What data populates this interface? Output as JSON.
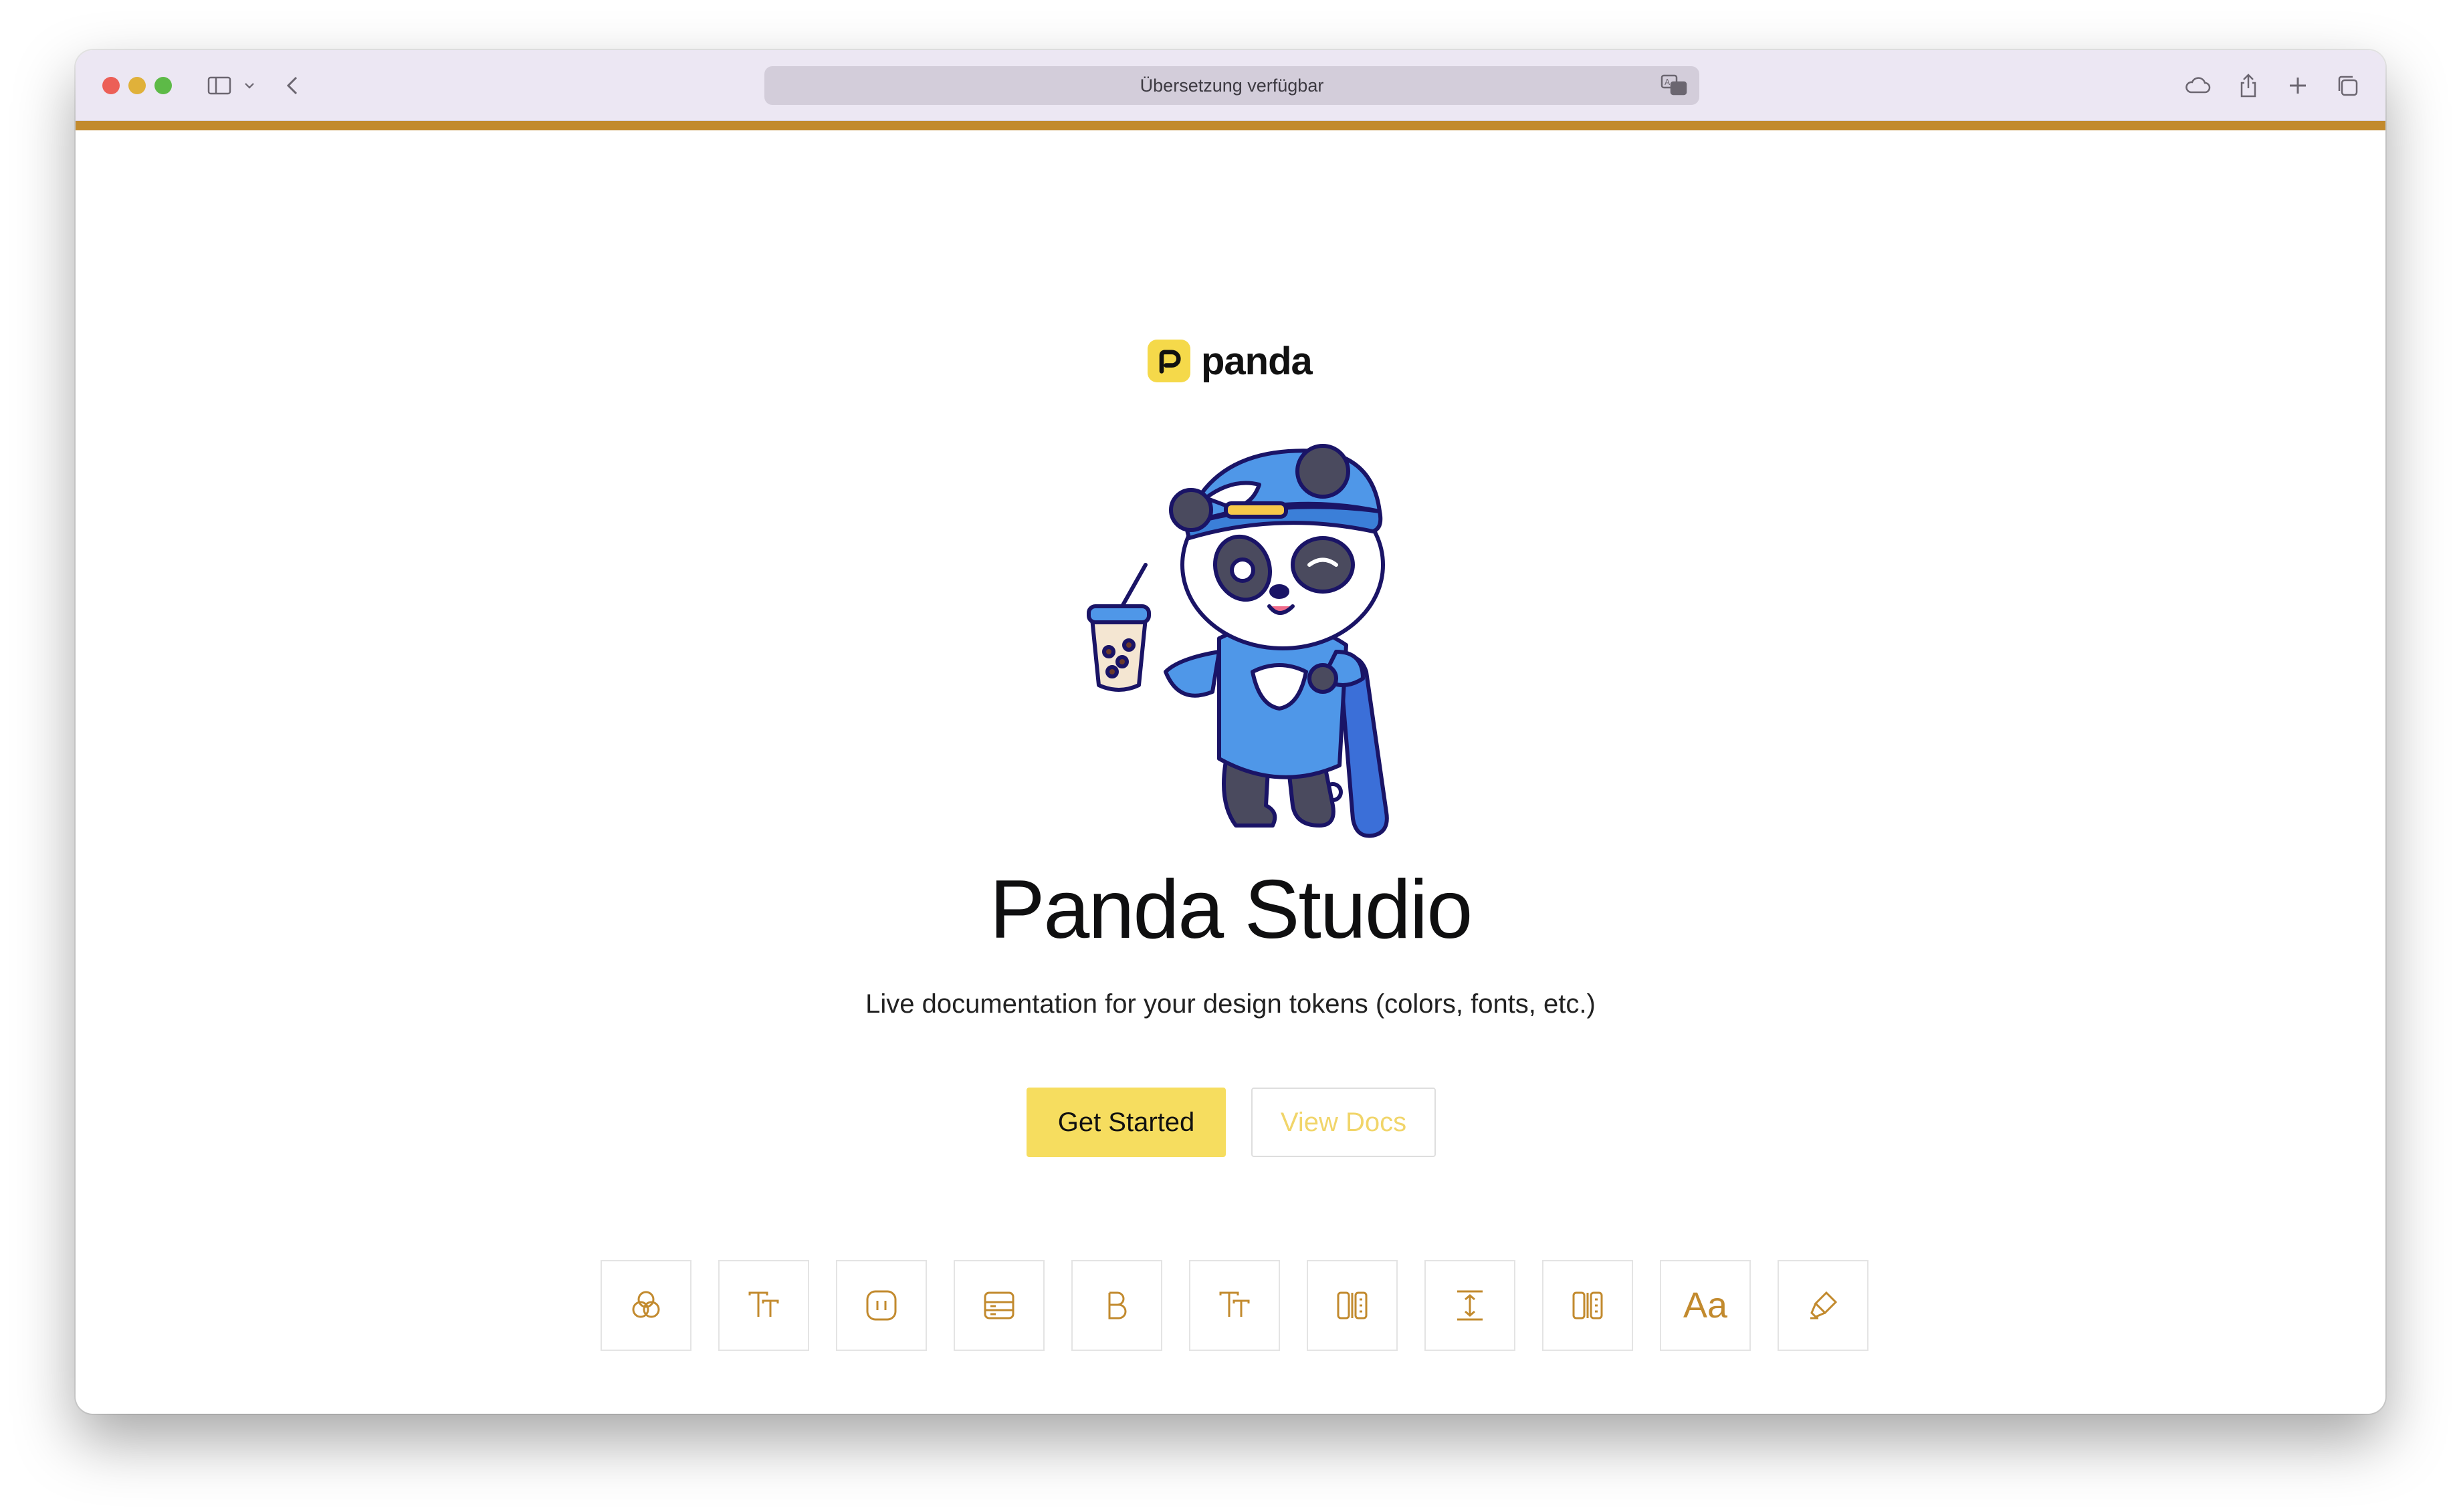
{
  "browser": {
    "address_bar_text": "Übersetzung verfügbar",
    "accent_color": "#c28a2e",
    "icons": [
      "sidebar-toggle-icon",
      "chevron-down-icon",
      "back-icon",
      "translate-icon",
      "icloud-icon",
      "share-icon",
      "new-tab-icon",
      "tabs-overview-icon"
    ]
  },
  "page": {
    "logo_text": "panda",
    "title": "Panda Studio",
    "subtitle": "Live documentation for your design tokens (colors, fonts, etc.)",
    "primary_button": "Get Started",
    "secondary_button": "View Docs",
    "brand_color": "#f6dd5f",
    "token_tiles": [
      {
        "icon": "colors-icon"
      },
      {
        "icon": "font-size-icon"
      },
      {
        "icon": "radius-icon"
      },
      {
        "icon": "layer-styles-icon"
      },
      {
        "icon": "font-weight-icon"
      },
      {
        "icon": "typography-icon"
      },
      {
        "icon": "letter-spacing-icon"
      },
      {
        "icon": "line-height-icon"
      },
      {
        "icon": "sizes-icon"
      },
      {
        "label": "Aa",
        "icon": "font-family-icon"
      },
      {
        "icon": "text-styles-icon"
      }
    ]
  }
}
